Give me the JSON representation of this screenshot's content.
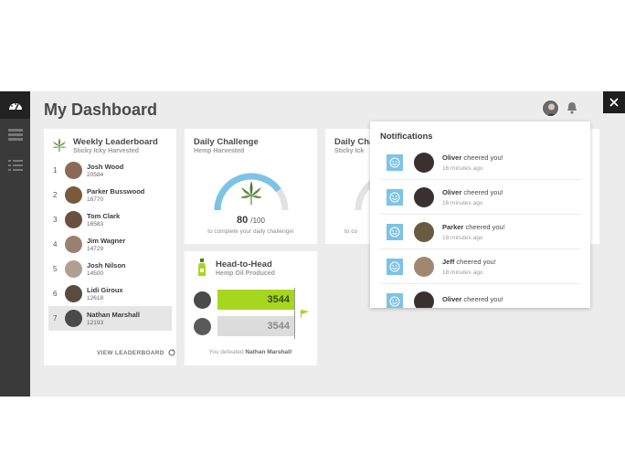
{
  "app": {
    "title": "My Dashboard"
  },
  "leaderboard": {
    "title": "Weekly Leaderboard",
    "subtitle": "Sticky Icky Harvested",
    "footer": "VIEW LEADERBOARD",
    "rows": [
      {
        "rank": "1",
        "name": "Josh Wood",
        "score": "20584",
        "avatar_color": "#8a6a55"
      },
      {
        "rank": "2",
        "name": "Parker Busswood",
        "score": "16770",
        "avatar_color": "#7a5a3a"
      },
      {
        "rank": "3",
        "name": "Tom Clark",
        "score": "16583",
        "avatar_color": "#6a5040"
      },
      {
        "rank": "4",
        "name": "Jim Wagner",
        "score": "14729",
        "avatar_color": "#9a8070"
      },
      {
        "rank": "5",
        "name": "Josh Nilson",
        "score": "14500",
        "avatar_color": "#b0a090"
      },
      {
        "rank": "6",
        "name": "Lidi Giroux",
        "score": "12618",
        "avatar_color": "#5a4a40"
      },
      {
        "rank": "7",
        "name": "Nathan Marshall",
        "score": "12193",
        "avatar_color": "#4a4a4a"
      }
    ]
  },
  "daily_challenge": {
    "title": "Daily Challenge",
    "subtitle": "Hemp Harvested",
    "value": "80",
    "total": "/100",
    "progress": 0.8,
    "note": "to complete your daily challenge!"
  },
  "daily_challenge_2": {
    "title": "Daily Cha",
    "subtitle": "Sticky Ick",
    "note": "to co"
  },
  "head_to_head": {
    "title": "Head-to-Head",
    "subtitle": "Hemp Oil Produced",
    "you_score": "3544",
    "opp_score": "3544",
    "footer_prefix": "You defeated ",
    "footer_name": "Nathan Marshall",
    "footer_suffix": "!"
  },
  "notifications": {
    "title": "Notifications",
    "items": [
      {
        "name": "Oliver",
        "text": " cheered you!",
        "time": "16 minutes ago"
      },
      {
        "name": "Oliver",
        "text": " cheered you!",
        "time": "16 minutes ago"
      },
      {
        "name": "Parker",
        "text": " cheered you!",
        "time": "18 minutes ago"
      },
      {
        "name": "Jeff",
        "text": " cheered you!",
        "time": "18 minutes ago"
      },
      {
        "name": "Oliver",
        "text": " cheered you!",
        "time": ""
      }
    ]
  },
  "colors": {
    "accent_green": "#a6d620",
    "accent_blue": "#7cc3e6",
    "rail": "#3a3a3a"
  },
  "icons": [
    "dashboard-icon",
    "inventory-icon",
    "list-icon",
    "close-icon",
    "bell-icon",
    "weed-leaf-icon",
    "bottle-icon",
    "flag-icon",
    "smile-icon",
    "refresh-icon"
  ]
}
